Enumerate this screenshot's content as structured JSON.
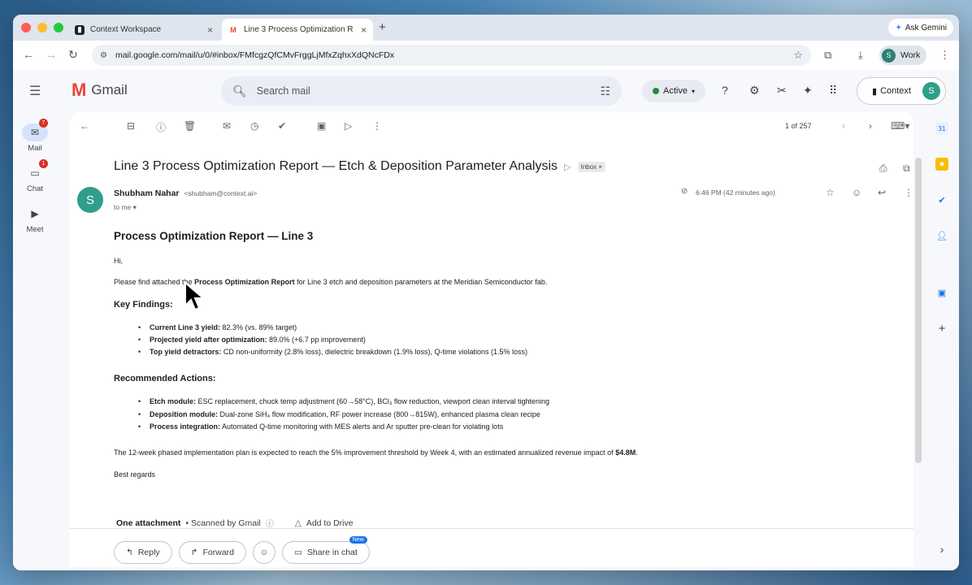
{
  "browser": {
    "tabs": [
      {
        "title": "Context Workspace",
        "icon": "context-icon"
      },
      {
        "title": "Line 3 Process Optimization R",
        "icon": "gmail-icon"
      }
    ],
    "ask_gemini": "Ask Gemini",
    "url": "mail.google.com/mail/u/0/#inbox/FMfcgzQfCMvFrggLjMfxZqhxXdQNcFDx",
    "profile_label": "Work",
    "profile_initial": "S"
  },
  "gmail": {
    "product_name": "Gmail",
    "search_placeholder": "Search mail",
    "status": "Active",
    "context_label": "Context",
    "avatar_initial": "S",
    "rail": [
      {
        "label": "Mail",
        "badge": "7"
      },
      {
        "label": "Chat",
        "badge": "1"
      },
      {
        "label": "Meet",
        "badge": ""
      }
    ],
    "page_info": "1 of 257"
  },
  "email": {
    "subject": "Line 3 Process Optimization Report — Etch & Deposition Parameter Analysis",
    "label": "Inbox",
    "sender_name": "Shubham Nahar",
    "sender_email": "<shubham@context.ai>",
    "sender_initial": "S",
    "to": "to me",
    "time": "6:46 PM (42 minutes ago)",
    "heading": "Process Optimization Report — Line 3",
    "greeting": "Hi,",
    "intro_pre": "Please find attached the ",
    "intro_bold": "Process Optimization Report",
    "intro_post": " for Line 3 etch and deposition parameters at the Meridian Semiconductor fab.",
    "key_findings_title": "Key Findings:",
    "key_findings": [
      {
        "label": "Current Line 3 yield:",
        "text": " 82.3% (vs. 89% target)"
      },
      {
        "label": "Projected yield after optimization:",
        "text": " 89.0% (+6.7 pp improvement)"
      },
      {
        "label": "Top yield detractors:",
        "text": " CD non-uniformity (2.8% loss), dielectric breakdown (1.9% loss), Q-time violations (1.5% loss)"
      }
    ],
    "actions_title": "Recommended Actions:",
    "actions": [
      {
        "label": "Etch module:",
        "text": " ESC replacement, chuck temp adjustment (60→58°C), BCl₃ flow reduction, viewport clean interval tightening"
      },
      {
        "label": "Deposition module:",
        "text": " Dual-zone SiH₄ flow modification, RF power increase (800→815W), enhanced plasma clean recipe"
      },
      {
        "label": "Process integration:",
        "text": " Automated Q-time monitoring with MES alerts and Ar sputter pre-clean for violating lots"
      }
    ],
    "closing_pre": "The 12-week phased implementation plan is expected to reach the 5% improvement threshold by Week 4, with an estimated annualized revenue impact of ",
    "closing_bold": "$4.8M",
    "closing_post": ".",
    "signoff": "Best regards",
    "attachment_count": "One attachment",
    "scanned": "• Scanned by Gmail",
    "add_to_drive": "Add to Drive",
    "reply": "Reply",
    "forward": "Forward",
    "share_in_chat": "Share in chat",
    "new_badge": "New"
  }
}
